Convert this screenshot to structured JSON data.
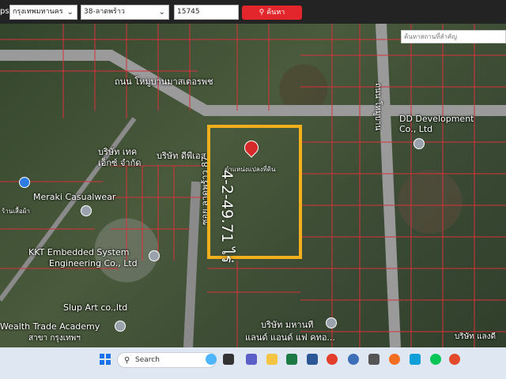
{
  "topbar": {
    "brand": "ps",
    "province": "กรุงเทพมหานคร",
    "district": "38-ลาดพร้าว",
    "parcel": "15745",
    "search_button": "ค้นหา"
  },
  "map": {
    "place_search_placeholder": "ค้นหาสถานที่สำคัญ",
    "labels": {
      "road_top": "ถนน โหมูบานมาสเตอรพช",
      "road_right": "ถนน โหมูบาน",
      "dd_dev": "DD Development",
      "dd_dev2": "Co., Ltd",
      "meraki": "Meraki Casualwear",
      "meraki_sub": "ร้านเสื้อผ้า",
      "kkt1": "KKT Embedded System",
      "kkt2": "Engineering Co., Ltd",
      "slup": "Slup Art co.,ltd",
      "wealth": "Wealth Trade Academy",
      "wealth2": "สาขา กรุงเทพฯ",
      "company_tech1": "บริษัท เทค",
      "company_tech2": "เอ็กซ์ จำกัด",
      "company_dpi": "บริษัท ดีพีเอส",
      "soi": "ซอย ลาดพร้าว 87",
      "land_company1": "บริษัท มหานที",
      "land_company2": "แลนด์ แอนด์ แฟ คทอ...",
      "bottom_right": "บริษัท แลงดี",
      "pin_label": "ตำแหน่งแปลงที่ดิน",
      "plot_area": "4-2-49.71 ไร่"
    }
  },
  "taskbar": {
    "search": "Search",
    "icons": [
      "copilot-icon",
      "file-explorer-icon",
      "teams-icon",
      "folder-icon",
      "excel-icon",
      "word-icon",
      "outlook-icon",
      "chrome-icon",
      "settings-icon",
      "calculator-icon",
      "firefox-icon",
      "edge-icon",
      "line-icon",
      "record-icon"
    ]
  },
  "colors": {
    "plot_border": "#f2b01d",
    "parcel_lines": "#d8313a",
    "search_button": "#e2262b"
  }
}
